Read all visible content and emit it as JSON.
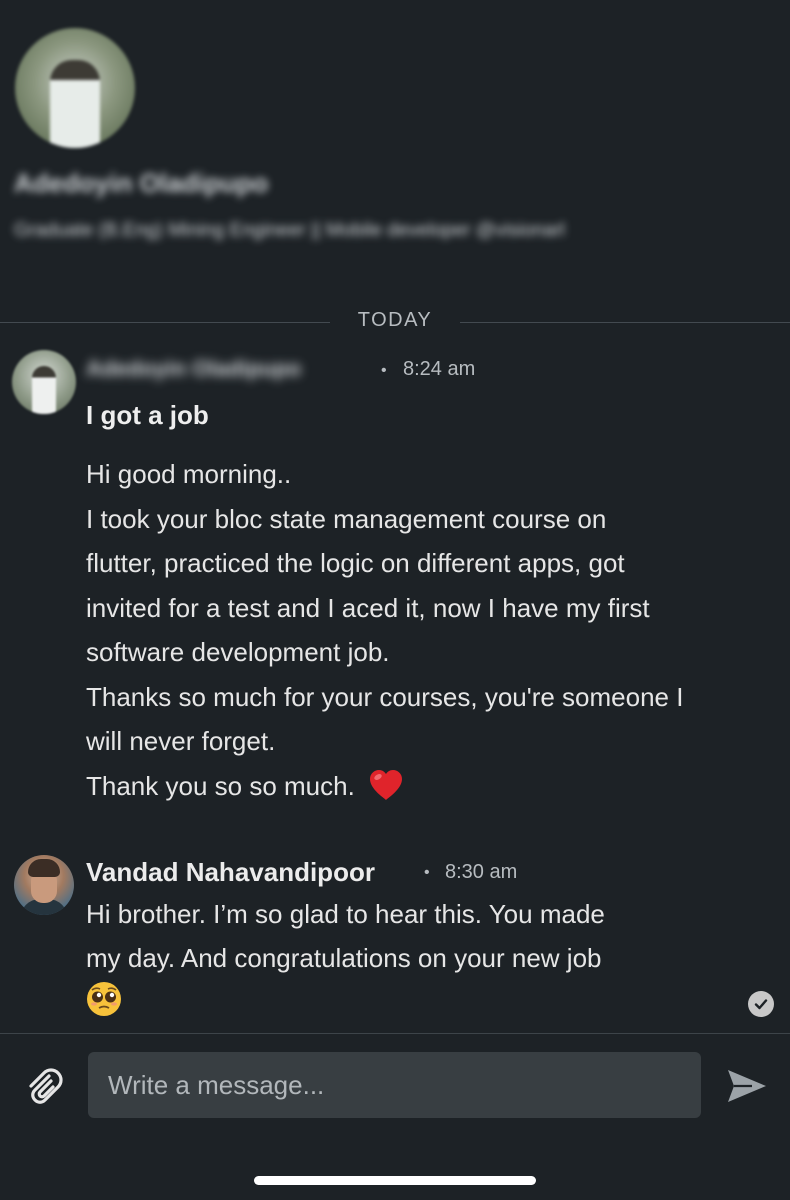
{
  "profile": {
    "name": "Adedoyin Oladipupo",
    "headline": "Graduate (B.Eng) Mining Engineer || Mobile developer @visionarl"
  },
  "date_separator": "TODAY",
  "messages": [
    {
      "sender": "Adedoyin Oladipupo",
      "time": "8:24 am",
      "subject": "I got a job",
      "lines": [
        "Hi good morning..",
        "I took your bloc state management course on",
        "flutter, practiced the logic on different apps, got",
        "invited for a test and I aced it, now I have my first",
        "software development job.",
        "Thanks so much for your courses, you're someone I",
        "will never forget.",
        "Thank you so so much."
      ]
    },
    {
      "sender": "Vandad Nahavandipoor",
      "time": "8:30 am",
      "lines": [
        "Hi brother. I’m so glad to hear this. You made",
        "my day. And congratulations on your new job"
      ]
    }
  ],
  "compose": {
    "placeholder": "Write a message..."
  },
  "icons": {
    "attach": "paperclip-icon",
    "send": "send-icon",
    "read_receipt": "check-icon",
    "reaction": "heart-icon",
    "emoji": "pleading-face-icon"
  }
}
